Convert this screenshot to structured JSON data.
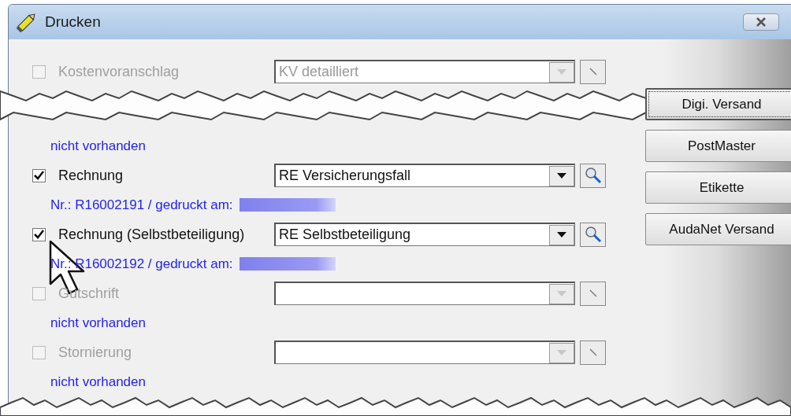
{
  "window": {
    "title": "Drucken"
  },
  "items": [
    {
      "kind": "document",
      "label": "Kostenvoranschlag",
      "checked": false,
      "disabled": true,
      "template": "KV detailliert"
    },
    {
      "kind": "tear"
    },
    {
      "kind": "info",
      "text": "nicht vorhanden"
    },
    {
      "kind": "document",
      "label": "Rechnung",
      "checked": true,
      "disabled": false,
      "template": "RE Versicherungsfall"
    },
    {
      "kind": "info",
      "text": "Nr.: R16002191 / gedruckt am:",
      "redacted": true
    },
    {
      "kind": "document",
      "label": "Rechnung (Selbstbeteiligung)",
      "checked": true,
      "disabled": false,
      "template": "RE Selbstbeteiligung"
    },
    {
      "kind": "info",
      "text": "Nr.: R16002192 / gedruckt am:",
      "redacted": true
    },
    {
      "kind": "document",
      "label": "Gutschrift",
      "checked": false,
      "disabled": true
    },
    {
      "kind": "info",
      "text": "nicht vorhanden"
    },
    {
      "kind": "document",
      "label": "Stornierung",
      "checked": false,
      "disabled": true
    },
    {
      "kind": "info",
      "text": "nicht vorhanden"
    }
  ],
  "buttons": [
    {
      "label": "Digi. Versand",
      "focused": true
    },
    {
      "label": "PostMaster",
      "focused": false
    },
    {
      "label": "Etikette",
      "focused": false
    },
    {
      "label": "AudaNet Versand",
      "focused": false
    }
  ]
}
